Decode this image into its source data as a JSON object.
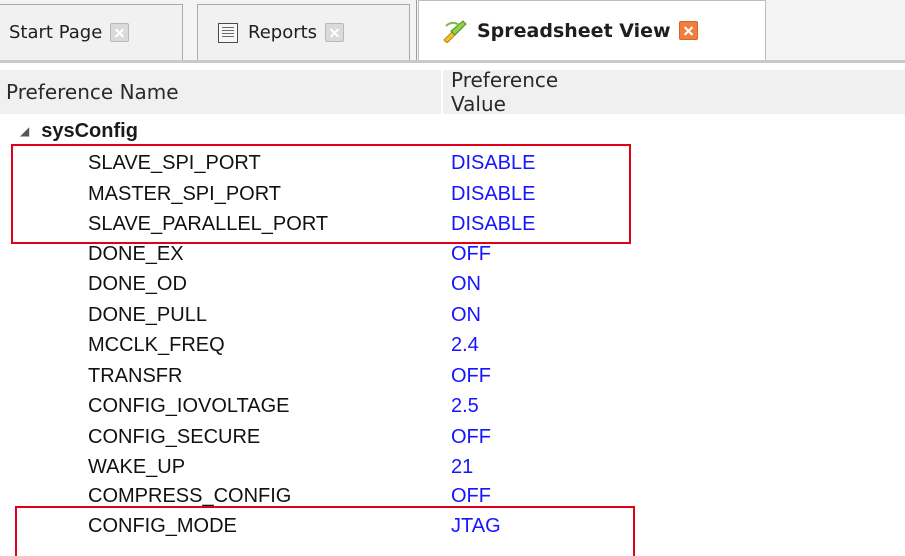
{
  "tabs": [
    {
      "label": "Start Page",
      "icon": "close-icon",
      "active": false
    },
    {
      "label": "Reports",
      "icon": "reports-icon",
      "active": false
    },
    {
      "label": "Spreadsheet View",
      "icon": "spreadsheet-icon",
      "active": true
    }
  ],
  "columns": {
    "name_header": "Preference Name",
    "value_header": "Preference Value"
  },
  "group": {
    "label": "sysConfig",
    "expanded": true
  },
  "rows": [
    {
      "name": "SLAVE_SPI_PORT",
      "value": "DISABLE",
      "highlighted": true
    },
    {
      "name": "MASTER_SPI_PORT",
      "value": "DISABLE",
      "highlighted": true
    },
    {
      "name": "SLAVE_PARALLEL_PORT",
      "value": "DISABLE",
      "highlighted": true
    },
    {
      "name": "DONE_EX",
      "value": "OFF"
    },
    {
      "name": "DONE_OD",
      "value": "ON"
    },
    {
      "name": "DONE_PULL",
      "value": "ON"
    },
    {
      "name": "MCCLK_FREQ",
      "value": "2.4"
    },
    {
      "name": "TRANSFR",
      "value": "OFF"
    },
    {
      "name": "CONFIG_IOVOLTAGE",
      "value": "2.5"
    },
    {
      "name": "CONFIG_SECURE",
      "value": "OFF"
    },
    {
      "name": "WAKE_UP",
      "value": "21"
    },
    {
      "name": "COMPRESS_CONFIG",
      "value": "OFF"
    },
    {
      "name": "CONFIG_MODE",
      "value": "JTAG",
      "highlighted": true
    }
  ],
  "colors": {
    "value_text": "#1515ff",
    "highlight_frame": "#e0001a",
    "active_close": "#f07e3f"
  }
}
